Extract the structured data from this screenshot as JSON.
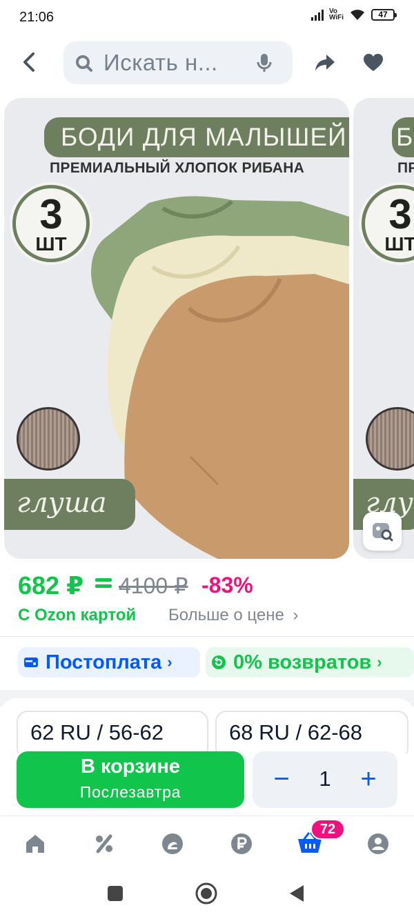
{
  "status_bar": {
    "time": "21:06",
    "network": "Vo\nWiFi",
    "battery": "47"
  },
  "header": {
    "search_placeholder": "Искать н..."
  },
  "product_image": {
    "banner_title": "БОДИ ДЛЯ МАЛЫШЕЙ",
    "banner_subtitle": "ПРЕМИАЛЬНЫЙ ХЛОПОК РИБАНА",
    "badge_number": "3",
    "badge_unit": "ШТ",
    "brand": "глуша",
    "next_banner_title": "Б",
    "next_banner_subtitle": "ПР",
    "next_badge_number": "3",
    "next_badge_unit": "ШТ",
    "next_brand": "глу",
    "colors": {
      "green": "#8fa57a",
      "cream": "#efe8c9",
      "tan": "#c99a6c",
      "banner": "#6e7f60"
    }
  },
  "price": {
    "current": "682 ₽",
    "old": "4100 ₽",
    "discount": "-83%",
    "card_label": "С Ozon картой",
    "more_label": "Больше о цене",
    "more_chevron": "›"
  },
  "chips": [
    {
      "label": "Постоплата",
      "chevron": "›",
      "icon": "wallet-icon"
    },
    {
      "label": "0% возвратов",
      "chevron": "›",
      "icon": "return-icon"
    }
  ],
  "sizes": [
    {
      "label": "62 RU / 56-62"
    },
    {
      "label": "68 RU / 62-68"
    }
  ],
  "cart": {
    "button_label": "В корзине",
    "delivery": "Послезавтра",
    "minus": "−",
    "quantity": "1",
    "plus": "+"
  },
  "bottom_nav": {
    "items": [
      "home-icon",
      "discount-icon",
      "fresh-icon",
      "finance-icon",
      "cart-icon",
      "profile-icon"
    ],
    "cart_badge": "72"
  },
  "theme": {
    "accent_blue": "#005bff",
    "accent_green": "#10c44c",
    "accent_pink": "#f1117e"
  }
}
